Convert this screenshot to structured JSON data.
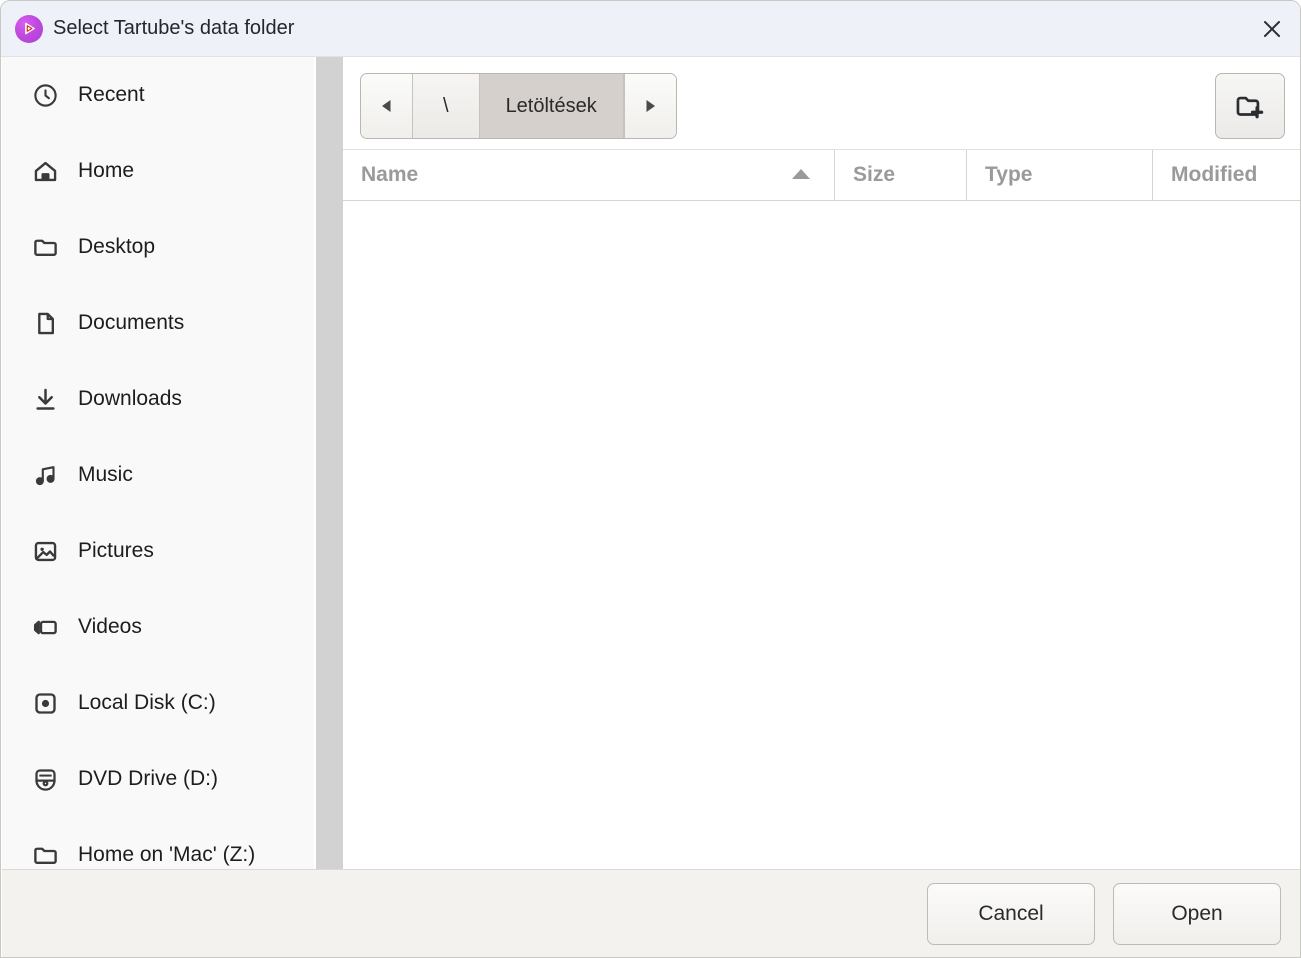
{
  "window": {
    "title": "Select Tartube's data folder",
    "app_icon": "tartube-play-icon",
    "close_icon": "close-icon",
    "titlebar_color": "#eef1f8",
    "accent_color": "#c04ae0"
  },
  "sidebar": {
    "items": [
      {
        "label": "Recent",
        "icon": "clock-icon"
      },
      {
        "label": "Home",
        "icon": "home-icon"
      },
      {
        "label": "Desktop",
        "icon": "folder-icon"
      },
      {
        "label": "Documents",
        "icon": "document-icon"
      },
      {
        "label": "Downloads",
        "icon": "download-icon"
      },
      {
        "label": "Music",
        "icon": "music-note-icon"
      },
      {
        "label": "Pictures",
        "icon": "image-icon"
      },
      {
        "label": "Videos",
        "icon": "video-camera-icon"
      },
      {
        "label": "Local Disk (C:)",
        "icon": "hard-drive-icon"
      },
      {
        "label": "DVD Drive (D:)",
        "icon": "optical-disc-icon"
      },
      {
        "label": "Home on 'Mac' (Z:)",
        "icon": "folder-icon"
      }
    ],
    "scrollbar": "vertical-scrollbar"
  },
  "pathbar": {
    "back_icon": "triangle-left-icon",
    "forward_icon": "triangle-right-icon",
    "crumbs": [
      {
        "label": "\\",
        "active": false
      },
      {
        "label": "Letöltések",
        "active": true
      }
    ],
    "new_folder_icon": "new-folder-icon"
  },
  "file_list": {
    "columns": [
      {
        "label": "Name",
        "sorted": true,
        "sort_direction": "ascending"
      },
      {
        "label": "Size",
        "sorted": false,
        "sort_direction": ""
      },
      {
        "label": "Type",
        "sorted": false,
        "sort_direction": ""
      },
      {
        "label": "Modified",
        "sorted": false,
        "sort_direction": ""
      }
    ],
    "rows": [],
    "empty": true
  },
  "actions": {
    "cancel_label": "Cancel",
    "open_label": "Open"
  }
}
